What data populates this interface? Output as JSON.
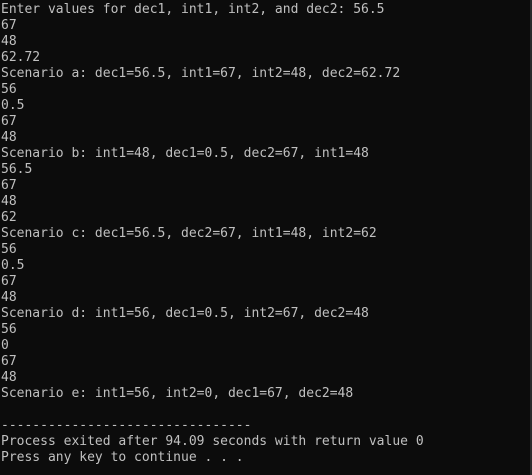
{
  "console": {
    "lines": [
      "Enter values for dec1, int1, int2, and dec2: 56.5",
      "67",
      "48",
      "62.72",
      "Scenario a: dec1=56.5, int1=67, int2=48, dec2=62.72",
      "56",
      "0.5",
      "67",
      "48",
      "Scenario b: int1=48, dec1=0.5, dec2=67, int1=48",
      "56.5",
      "67",
      "48",
      "62",
      "Scenario c: dec1=56.5, dec2=67, int1=48, int2=62",
      "56",
      "0.5",
      "67",
      "48",
      "Scenario d: int1=56, dec1=0.5, int2=67, dec2=48",
      "56",
      "0",
      "67",
      "48",
      "Scenario e: int1=56, int2=0, dec1=67, dec2=48",
      "",
      "--------------------------------",
      "Process exited after 94.09 seconds with return value 0",
      "Press any key to continue . . ."
    ]
  }
}
